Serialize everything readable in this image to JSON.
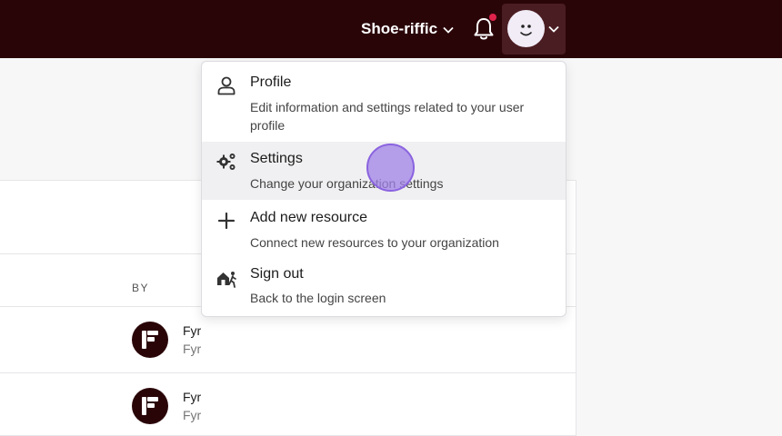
{
  "topbar": {
    "org_name": "Shoe-riffic",
    "notifications_icon": "bell-icon",
    "has_unread": true,
    "avatar_icon": "user-avatar",
    "accent_color": "#2a0508",
    "badge_color": "#e0234b"
  },
  "menu": {
    "items": [
      {
        "title": "Profile",
        "description": "Edit information and settings related to your user profile",
        "icon": "user-icon"
      },
      {
        "title": "Settings",
        "description": "Change your organization settings",
        "icon": "gears-icon",
        "hovered": true
      },
      {
        "title": "Add new resource",
        "description": "Connect new resources to your organization",
        "icon": "plus-icon"
      },
      {
        "title": "Sign out",
        "description": "Back to the login screen",
        "icon": "sign-out-icon"
      }
    ]
  },
  "table": {
    "column_by": "BY",
    "rows": [
      {
        "name": "Fyr",
        "sub": "Fyr"
      },
      {
        "name": "Fyr",
        "sub": "Fyr"
      }
    ]
  }
}
